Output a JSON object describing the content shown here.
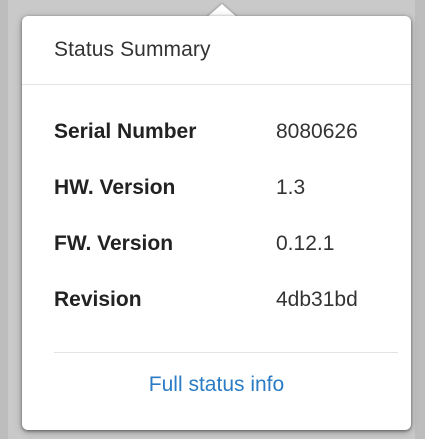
{
  "popover": {
    "title": "Status Summary",
    "rows": [
      {
        "label": "Serial Number",
        "value": "8080626"
      },
      {
        "label": "HW. Version",
        "value": "1.3"
      },
      {
        "label": "FW. Version",
        "value": "0.12.1"
      },
      {
        "label": "Revision",
        "value": "4db31bd"
      }
    ],
    "footer_link": "Full status info"
  },
  "colors": {
    "link": "#2b7cc4",
    "background": "#c9c9c9",
    "card": "#ffffff"
  }
}
